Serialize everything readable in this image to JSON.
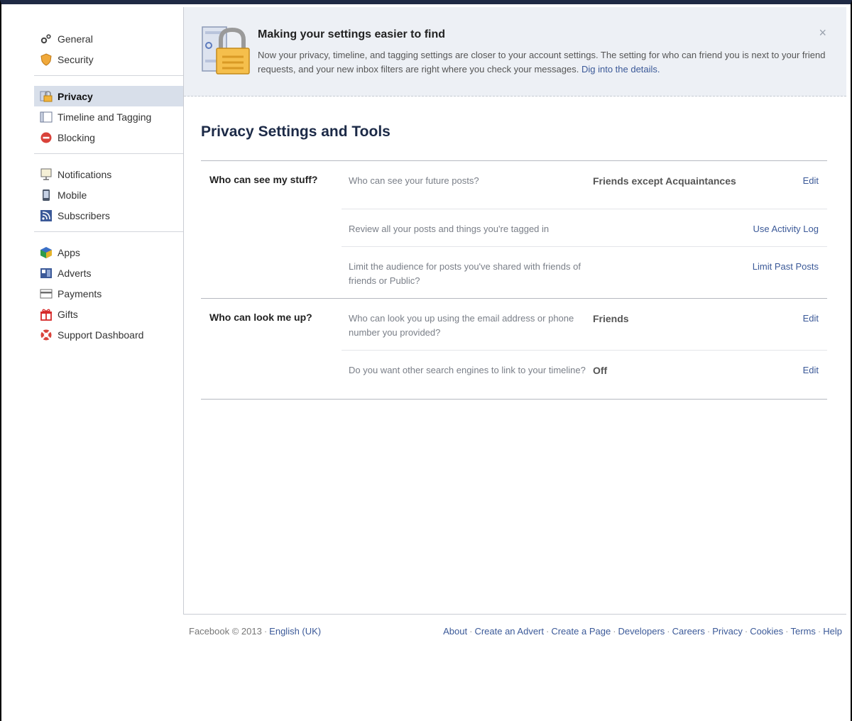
{
  "sidebar": {
    "groups": [
      {
        "items": [
          {
            "label": "General",
            "icon": "gears-icon"
          },
          {
            "label": "Security",
            "icon": "shield-icon"
          }
        ]
      },
      {
        "items": [
          {
            "label": "Privacy",
            "icon": "lock-icon",
            "active": true
          },
          {
            "label": "Timeline and Tagging",
            "icon": "timeline-icon"
          },
          {
            "label": "Blocking",
            "icon": "block-icon"
          }
        ]
      },
      {
        "items": [
          {
            "label": "Notifications",
            "icon": "notification-icon"
          },
          {
            "label": "Mobile",
            "icon": "mobile-icon"
          },
          {
            "label": "Subscribers",
            "icon": "rss-icon"
          }
        ]
      },
      {
        "items": [
          {
            "label": "Apps",
            "icon": "apps-icon"
          },
          {
            "label": "Adverts",
            "icon": "adverts-icon"
          },
          {
            "label": "Payments",
            "icon": "credit-card-icon"
          },
          {
            "label": "Gifts",
            "icon": "gift-icon"
          },
          {
            "label": "Support Dashboard",
            "icon": "lifebuoy-icon"
          }
        ]
      }
    ]
  },
  "notice": {
    "title": "Making your settings easier to find",
    "text": "Now your privacy, timeline, and tagging settings are closer to your account settings. The setting for who can friend you is next to your friend requests, and your new inbox filters are right where you check your messages.",
    "link": "Dig into the details.",
    "close": "×"
  },
  "main": {
    "title": "Privacy Settings and Tools",
    "sections": [
      {
        "label": "Who can see my stuff?",
        "rows": [
          {
            "question": "Who can see your future posts?",
            "value": "Friends except Acquaintances",
            "action": "Edit"
          },
          {
            "question": "Review all your posts and things you're tagged in",
            "value": "",
            "action": "Use Activity Log"
          },
          {
            "question": "Limit the audience for posts you've shared with friends of friends or Public?",
            "value": "",
            "action": "Limit Past Posts"
          }
        ]
      },
      {
        "label": "Who can look me up?",
        "rows": [
          {
            "question": "Who can look you up using the email address or phone number you provided?",
            "value": "Friends",
            "action": "Edit"
          },
          {
            "question": "Do you want other search engines to link to your timeline?",
            "value": "Off",
            "action": "Edit"
          }
        ]
      }
    ]
  },
  "footer": {
    "copyright": "Facebook © 2013",
    "language": "English (UK)",
    "separator": "·",
    "links": [
      "About",
      "Create an Advert",
      "Create a Page",
      "Developers",
      "Careers",
      "Privacy",
      "Cookies",
      "Terms",
      "Help"
    ]
  },
  "colors": {
    "link": "#3b5998",
    "active_bg": "#d8dfea",
    "notice_bg": "#edf0f5",
    "title": "#1c2a47"
  }
}
